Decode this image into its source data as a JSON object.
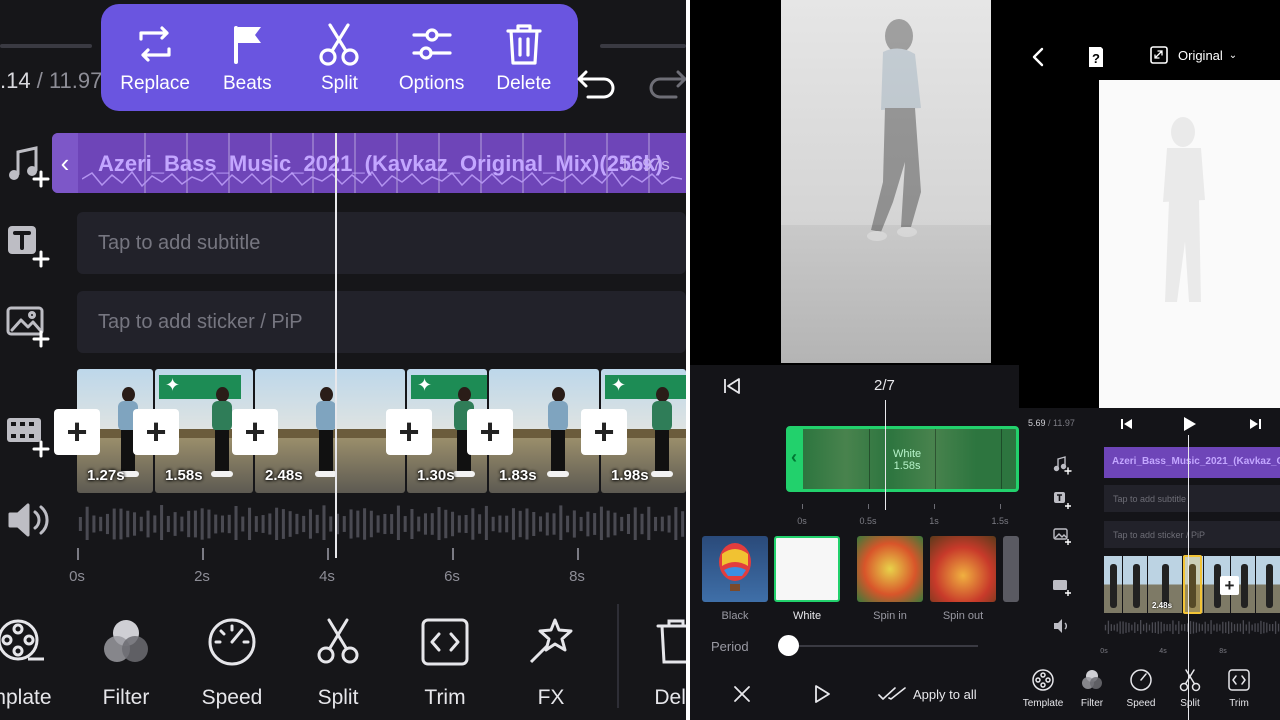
{
  "left": {
    "time_current": ".14",
    "time_total": "/ 11.97",
    "context_menu": [
      {
        "label": "Replace",
        "icon": "replace-icon"
      },
      {
        "label": "Beats",
        "icon": "flag-icon"
      },
      {
        "label": "Split",
        "icon": "scissors-icon"
      },
      {
        "label": "Options",
        "icon": "sliders-icon"
      },
      {
        "label": "Delete",
        "icon": "trash-icon"
      }
    ],
    "music_title": "Azeri_Bass_Music_2021_(Kavkaz_Original_Mix)(256k)",
    "music_duration": "11.97s",
    "subtitle_placeholder": "Tap to add subtitle",
    "sticker_placeholder": "Tap to add sticker / PiP",
    "clips": [
      {
        "duration": "1.27s"
      },
      {
        "duration": "1.58s"
      },
      {
        "duration": "2.48s"
      },
      {
        "duration": "1.30s"
      },
      {
        "duration": "1.83s"
      },
      {
        "duration": "1.98s"
      }
    ],
    "ruler_labels": [
      "0s",
      "2s",
      "4s",
      "6s",
      "8s"
    ],
    "toolbar": [
      "mplate",
      "Filter",
      "Speed",
      "Split",
      "Trim",
      "FX",
      "Dele"
    ]
  },
  "preview": {
    "aspect_label": "Original"
  },
  "transition": {
    "counter": "2/7",
    "strip_label": "White",
    "strip_duration": "1.58s",
    "ruler_labels": [
      "0s",
      "0.5s",
      "1s",
      "1.5s"
    ],
    "options": [
      {
        "label": "Black",
        "selected": false
      },
      {
        "label": "White",
        "selected": true
      },
      {
        "label": "Spin in",
        "selected": false
      },
      {
        "label": "Spin out",
        "selected": false
      }
    ],
    "period_label": "Period",
    "period_value": 0,
    "apply_all": "Apply to all"
  },
  "mini": {
    "time_current": "5.69",
    "time_total": " / 11.97",
    "music_title": "Azeri_Bass_Music_2021_(Kavkaz_Original_Mix)(256k)",
    "subtitle_placeholder": "Tap to add subtitle",
    "sticker_placeholder": "Tap to add sticker / PiP",
    "clip_duration": "2.48s",
    "ruler_labels": [
      "0s",
      "4s",
      "8s"
    ],
    "toolbar": [
      "Template",
      "Filter",
      "Speed",
      "Split",
      "Trim"
    ]
  },
  "colors": {
    "accent_purple": "#6a55e0",
    "music_purple": "#6e45b8",
    "transition_green": "#22d16c",
    "selection_yellow": "#f3c437"
  }
}
